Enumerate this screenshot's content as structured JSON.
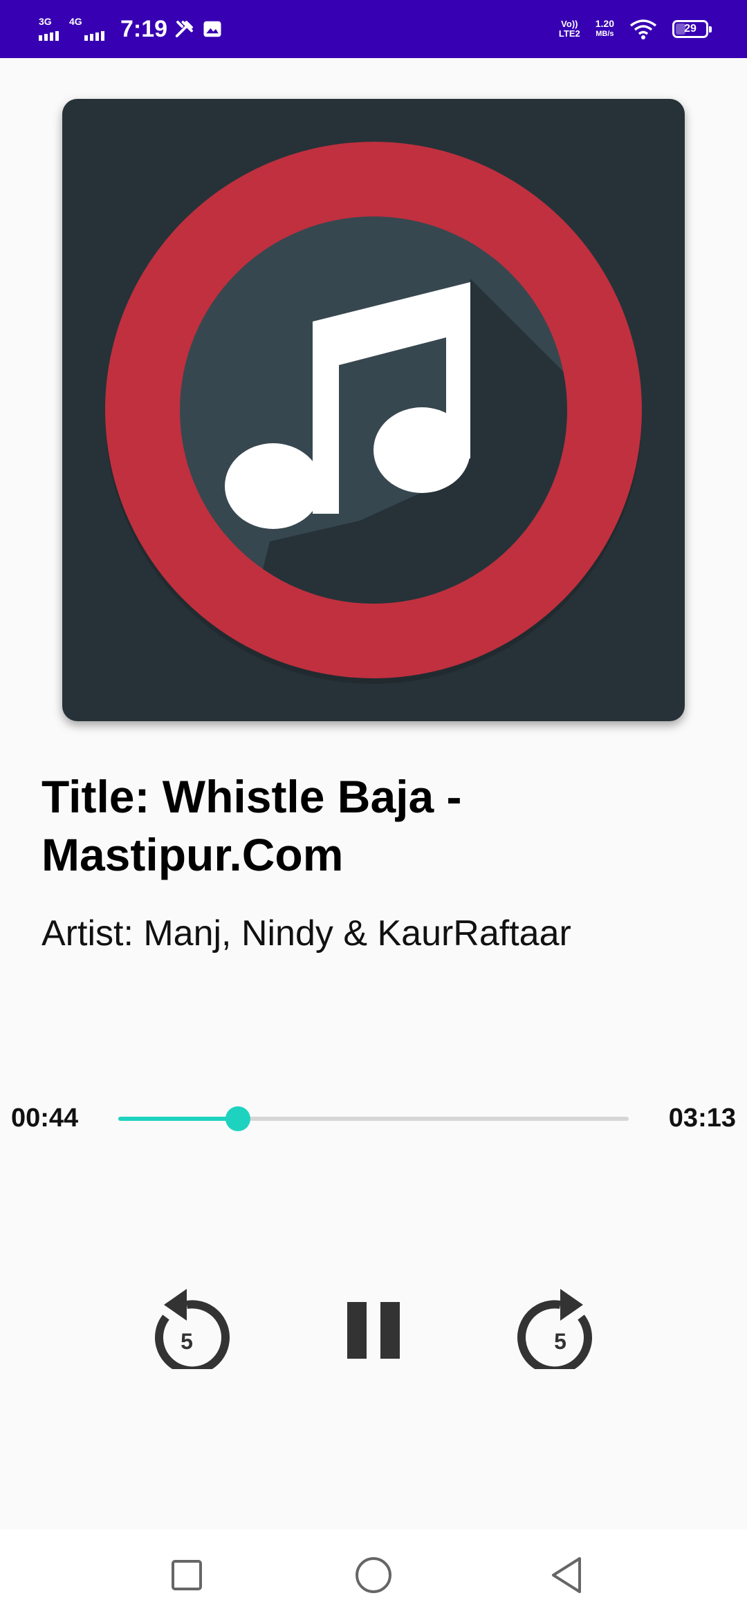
{
  "status_bar": {
    "network1": "3G",
    "network2": "4G",
    "time": "7:19",
    "volte_line1": "Vo))",
    "volte_line2": "LTE2",
    "speed_value": "1.20",
    "speed_unit": "MB/s",
    "battery_level": "29",
    "colors": {
      "background": "#3700b3"
    }
  },
  "album_art": {
    "icon": "music-note-icon"
  },
  "song": {
    "title": "Title: Whistle Baja - Mastipur.Com",
    "artist": "Artist: Manj, Nindy & KaurRaftaar"
  },
  "player": {
    "current_time": "00:44",
    "total_time": "03:13",
    "progress": 0.234,
    "accent_color": "#1dd3c0",
    "rewind_label": "5",
    "forward_label": "5",
    "rewind_icon": "replay-5-icon",
    "pause_icon": "pause-icon",
    "forward_icon": "forward-5-icon"
  },
  "nav_bar": {
    "recents_icon": "square-icon",
    "home_icon": "circle-icon",
    "back_icon": "triangle-back-icon"
  }
}
